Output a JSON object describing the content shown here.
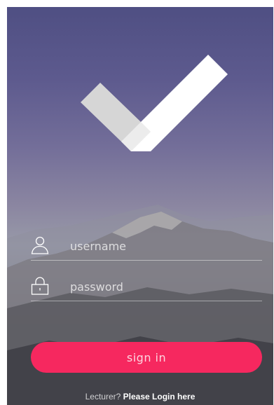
{
  "login": {
    "username_placeholder": "username",
    "password_placeholder": "password",
    "signin_label": "sign in",
    "lecturer_prompt": "Lecturer?",
    "lecturer_link": "Please Login here"
  },
  "icons": {
    "logo": "checkmark-icon",
    "username": "user-icon",
    "password": "lock-icon"
  },
  "colors": {
    "accent": "#f6285f",
    "text": "#ffffff"
  }
}
